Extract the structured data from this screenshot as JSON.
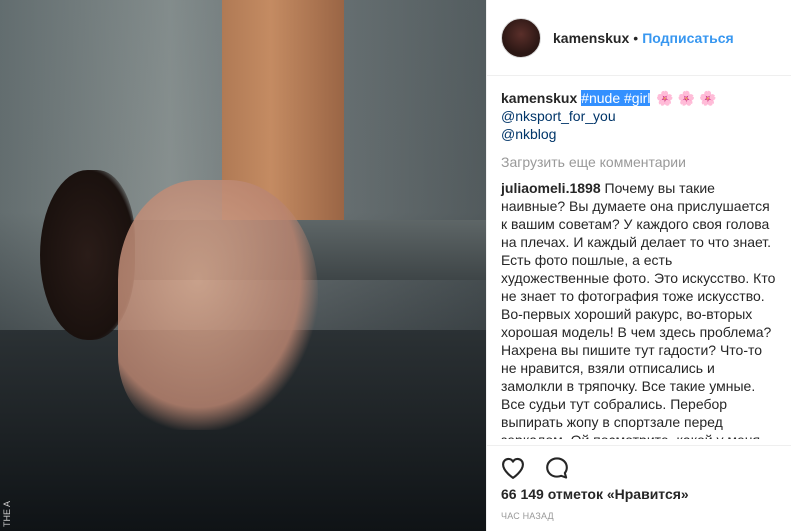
{
  "post": {
    "username": "kamenskux",
    "separator": "•",
    "follow_label": "Подписаться"
  },
  "caption": {
    "username": "kamenskux",
    "hashtags": "#nude #girl",
    "emoji": "🌸 🌸 🌸",
    "mentions": [
      "@nksport_for_you",
      "@nkblog"
    ]
  },
  "load_more_label": "Загрузить еще комментарии",
  "comment": {
    "username": "juliaomeli.1898",
    "text": "Почему вы такие наивные? Вы думаете она прислушается к вашим советам? У каждого своя голова на плечах. И каждый делает то что знает. Есть фото пошлые, а есть художественные фото. Это искусство. Кто не знает то фотография тоже искусство. Во-первых хороший ракурс, во-вторых хорошая модель! В чем здесь проблема? Нахрена вы пишите тут гадости? Что-то не нравится, взяли отписались и замолкли в тряпочку. Все такие умные. Все судьи тут собрались. Перебор выпирать жопу в спортзале перед зеркалом. Ой посмотрите, какой у меня"
  },
  "actions": {
    "like_icon": "heart-icon",
    "comment_icon": "comment-icon"
  },
  "likes_label": "66 149 отметок «Нравится»",
  "timestamp": "ЧАС НАЗАД",
  "photo": {
    "watermark": "THE A"
  }
}
